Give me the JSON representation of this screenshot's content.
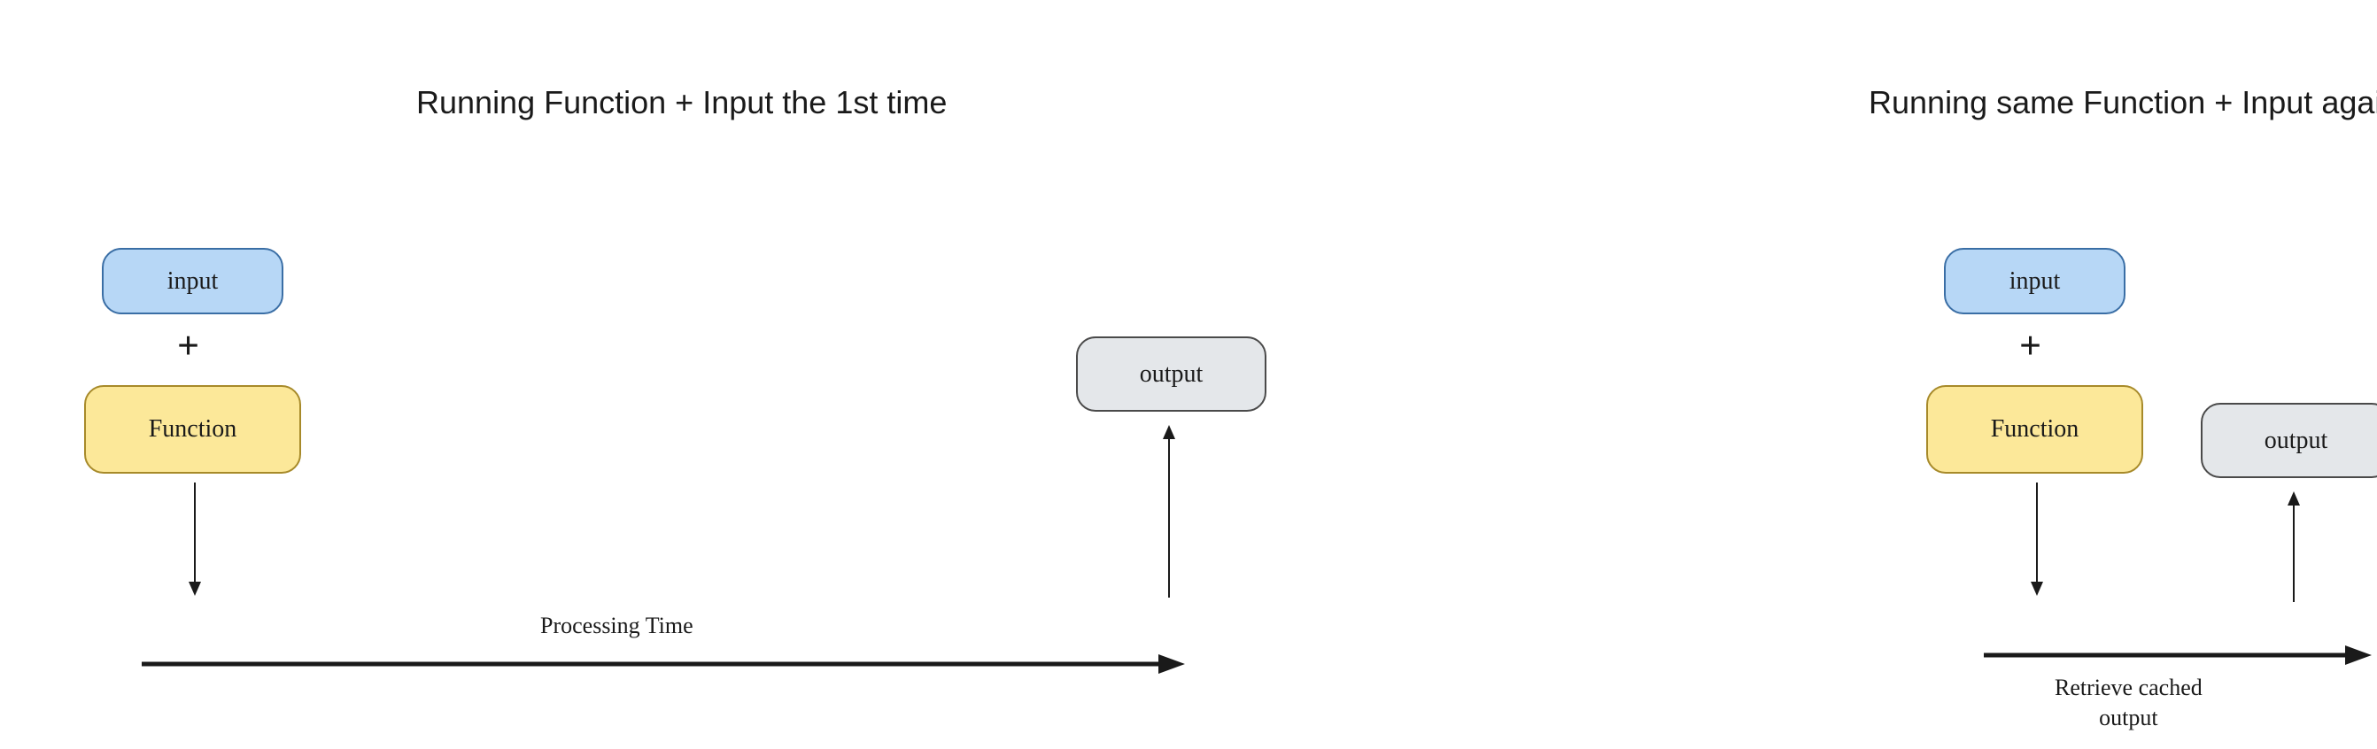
{
  "left": {
    "title": "Running Function + Input the 1st time",
    "input_label": "input",
    "plus": "+",
    "function_label": "Function",
    "output_label": "output",
    "timeline_label": "Processing Time"
  },
  "right": {
    "title": "Running same Function + Input again",
    "input_label": "input",
    "plus": "+",
    "function_label": "Function",
    "output_label": "output",
    "timeline_label": "Retrieve cached output"
  },
  "colors": {
    "input_fill": "#b7d7f6",
    "input_border": "#3a6ea5",
    "function_fill": "#fce899",
    "function_border": "#a78a2a",
    "output_fill": "#e4e7ea",
    "output_border": "#4a4a4a",
    "ink": "#1a1a1a"
  }
}
